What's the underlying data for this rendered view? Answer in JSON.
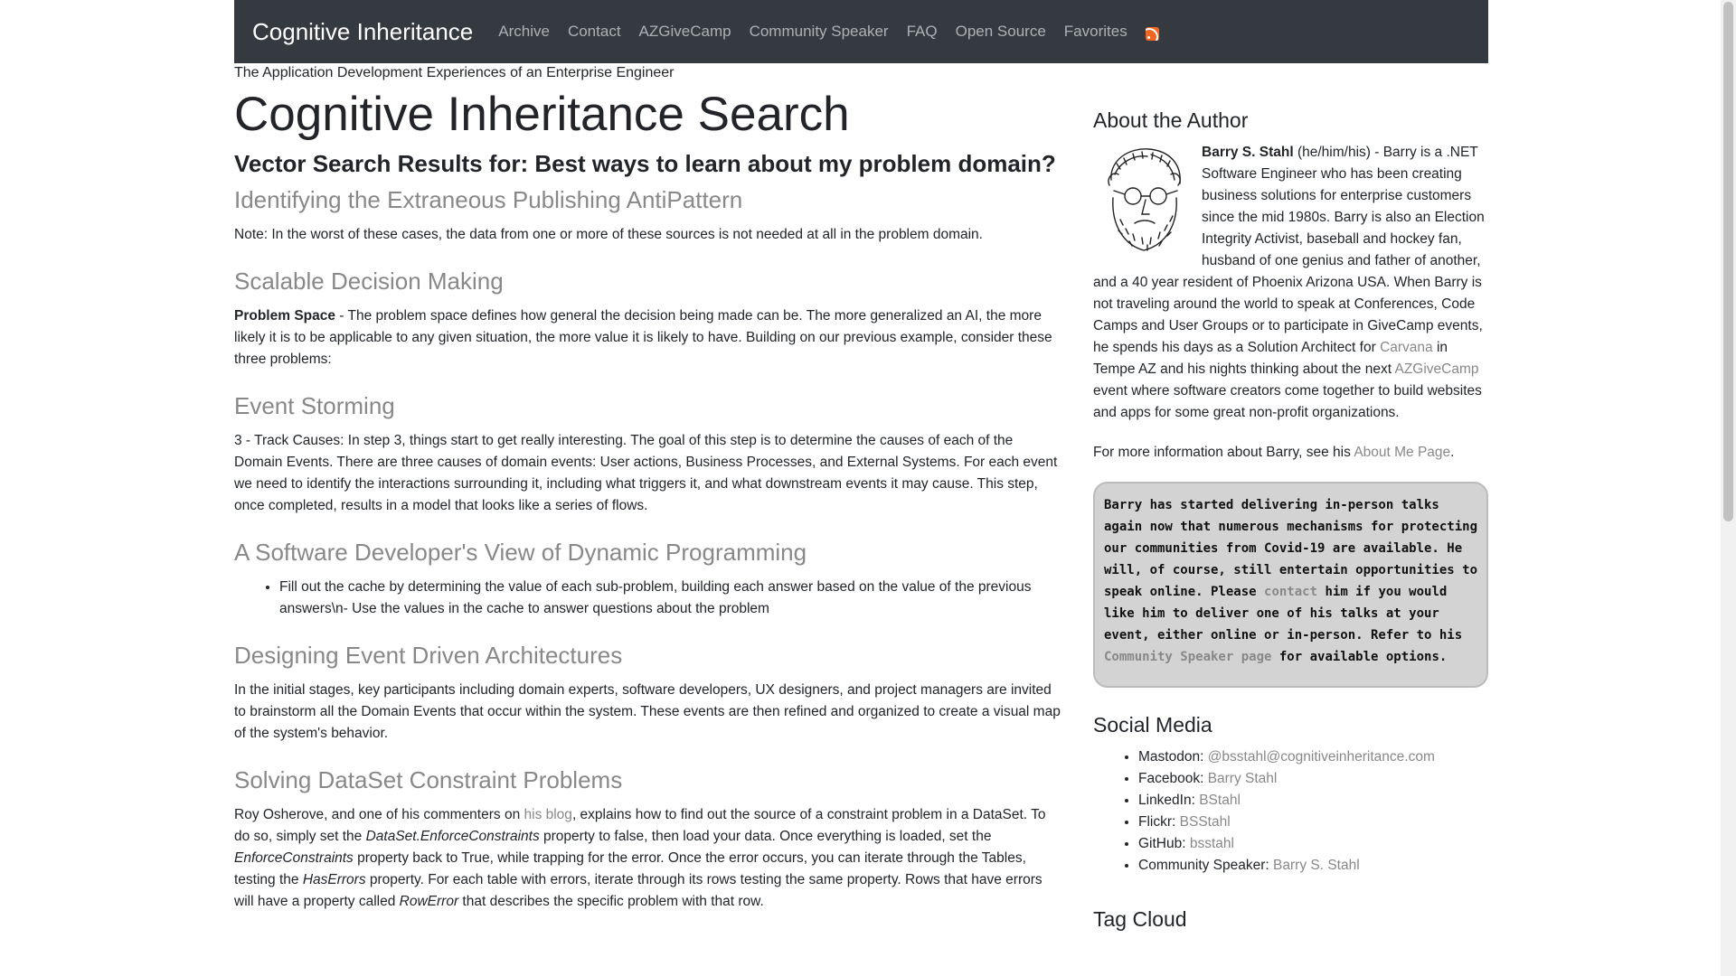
{
  "nav": {
    "brand": "Cognitive Inheritance",
    "items": [
      "Archive",
      "Contact",
      "AZGiveCamp",
      "Community Speaker",
      "FAQ",
      "Open Source",
      "Favorites"
    ],
    "rss_icon": "rss-icon"
  },
  "tagline": "The Application Development Experiences of an Enterprise Engineer",
  "main": {
    "title": "Cognitive Inheritance Search",
    "results_heading": "Vector Search Results for: Best ways to learn about my problem domain?",
    "results": [
      {
        "title": "Identifying the Extraneous Publishing AntiPattern",
        "text": "Note: In the worst of these cases, the data from one or more of these sources is not needed at all in the problem domain."
      },
      {
        "title": "Scalable Decision Making",
        "bold": "Problem Space",
        "text": " - The problem space defines how general the decision being made can be. The more generalized an AI, the more likely it is to be applicable to any given situation, the more value it is likely to have. Building on our previous example, consider these three problems:"
      },
      {
        "title": "Event Storming",
        "text": "3 - Track Causes: In step 3, things start to get really interesting. The goal of this step is to determine the causes of each of the Domain Events. There are three causes of domain events: User actions, Business Processes, and External Systems. For each event we need to identify the interactions surrounding it, including what triggers it, and what downstream events it may cause. This step, once completed, results in a model that looks like a series of flows."
      },
      {
        "title": "A Software Developer's View of Dynamic Programming",
        "list_item": "Fill out the cache by determining the value of each sub-problem, building each answer based on the value of the previous answers\\n- Use the values in the cache to answer questions about the problem"
      },
      {
        "title": "Designing Event Driven Architectures",
        "text": "In the initial stages, key participants including domain experts, software developers, UX designers, and project managers are invited to brainstorm all the Domain Events that occur within the system. These events are then refined and organized to create a visual map of the system's behavior."
      },
      {
        "title": "Solving DataSet Constraint Problems",
        "t1": "Roy Osherove, and one of his commenters on ",
        "link": "his blog",
        "t2": ", explains how to find out the source of a constraint problem in a DataSet. To do so, simply set the ",
        "em1": "DataSet.EnforceConstraints",
        "t3": " property to false, then load your data. Once everything is loaded, set the ",
        "em2": "EnforceConstraints",
        "t4": " property back to True, while trapping for the error. Once the error occurs, you can iterate through the Tables, testing the ",
        "em3": "HasErrors",
        "t5": " property. For each table with errors, iterate through its rows testing the same property. Rows that have errors will have a property called ",
        "em4": "RowError",
        "t6": " that describes the specific problem with that row."
      }
    ]
  },
  "sidebar": {
    "about_heading": "About the Author",
    "author_name": "Barry S. Stahl",
    "author_text1": " (he/him/his) - Barry is a .NET Software Engineer who has been creating business solutions for enterprise customers since the mid 1980s. Barry is also an Election Integrity Activist, baseball and hockey fan, husband of one genius and father of another, and a 40 year resident of Phoenix Arizona USA. When Barry is not traveling around the world to speak at Conferences, Code Camps and User Groups or to participate in GiveCamp events, he spends his days as a Solution Architect for ",
    "carvana_link": "Carvana",
    "author_text2": " in Tempe AZ and his nights thinking about the next ",
    "azgivecamp_link": "AZGiveCamp",
    "author_text3": " event where software creators come together to build websites and apps for some great non-profit organizations.",
    "more_text1": "For more information about Barry, see his ",
    "more_link": "About Me Page",
    "more_text2": ".",
    "callout_text1": "Barry has started delivering in-person talks again now that numerous mechanisms for protecting our communities from Covid-19 are available. He will, of course, still entertain opportunities to speak online. Please ",
    "callout_link1": "contact",
    "callout_text2": " him if you would like him to deliver one of his talks at your event, either online or in-person. Refer to his ",
    "callout_link2": "Community Speaker page",
    "callout_text3": " for available options.",
    "social_heading": "Social Media",
    "social": [
      {
        "label": "Mastodon: ",
        "value": "@bsstahl@cognitiveinheritance.com"
      },
      {
        "label": "Facebook: ",
        "value": "Barry Stahl"
      },
      {
        "label": "LinkedIn: ",
        "value": "BStahl"
      },
      {
        "label": "Flickr: ",
        "value": "BSStahl"
      },
      {
        "label": "GitHub: ",
        "value": "bsstahl"
      },
      {
        "label": "Community Speaker: ",
        "value": "Barry S. Stahl"
      }
    ],
    "tagcloud_heading": "Tag Cloud"
  }
}
